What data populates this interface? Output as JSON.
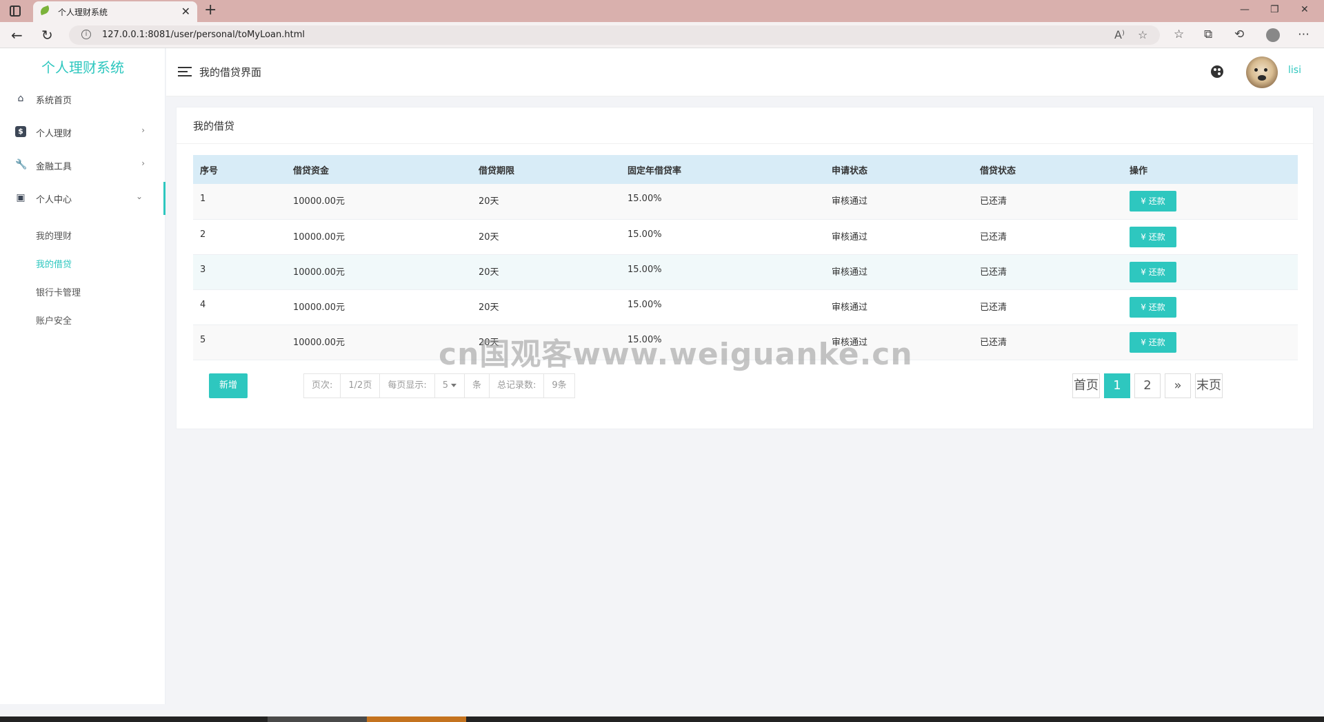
{
  "browser": {
    "tab_title": "个人理财系统",
    "url": "127.0.0.1:8081/user/personal/toMyLoan.html"
  },
  "sidebar": {
    "brand": "个人理财系统",
    "items": [
      {
        "label": "系统首页",
        "icon": "home-icon"
      },
      {
        "label": "个人理财",
        "icon": "dollar-icon"
      },
      {
        "label": "金融工具",
        "icon": "wrench-icon"
      },
      {
        "label": "个人中心",
        "icon": "user-card-icon"
      }
    ],
    "subitems": [
      {
        "label": "我的理财"
      },
      {
        "label": "我的借贷"
      },
      {
        "label": "银行卡管理"
      },
      {
        "label": "账户安全"
      }
    ],
    "active_subitem": "我的借贷",
    "accent_color": "#2ec7bf"
  },
  "header": {
    "page_title": "我的借贷界面",
    "username": "lisi"
  },
  "card": {
    "title": "我的借贷"
  },
  "table": {
    "columns": [
      "序号",
      "借贷资金",
      "借贷期限",
      "固定年借贷率",
      "申请状态",
      "借贷状态",
      "操作"
    ],
    "rows": [
      {
        "no": "1",
        "amount": "10000.00元",
        "term": "20天",
        "rate": "15.00%",
        "apply_status": "审核通过",
        "loan_status": "已还清",
        "action": "还款"
      },
      {
        "no": "2",
        "amount": "10000.00元",
        "term": "20天",
        "rate": "15.00%",
        "apply_status": "审核通过",
        "loan_status": "已还清",
        "action": "还款"
      },
      {
        "no": "3",
        "amount": "10000.00元",
        "term": "20天",
        "rate": "15.00%",
        "apply_status": "审核通过",
        "loan_status": "已还清",
        "action": "还款"
      },
      {
        "no": "4",
        "amount": "10000.00元",
        "term": "20天",
        "rate": "15.00%",
        "apply_status": "审核通过",
        "loan_status": "已还清",
        "action": "还款"
      },
      {
        "no": "5",
        "amount": "10000.00元",
        "term": "20天",
        "rate": "15.00%",
        "apply_status": "审核通过",
        "loan_status": "已还清",
        "action": "还款"
      }
    ]
  },
  "footer": {
    "add_label": "新增",
    "page_label": "页次:",
    "page_value": "1/2页",
    "per_page_label": "每页显示:",
    "per_page_value": "5",
    "per_page_unit": "条",
    "total_label": "总记录数:",
    "total_value": "9条"
  },
  "pager": {
    "first": "首页",
    "pages": [
      "1",
      "2"
    ],
    "next": "»",
    "last": "末页",
    "current": "1"
  },
  "watermark": "cn国观客www.weiguanke.cn"
}
